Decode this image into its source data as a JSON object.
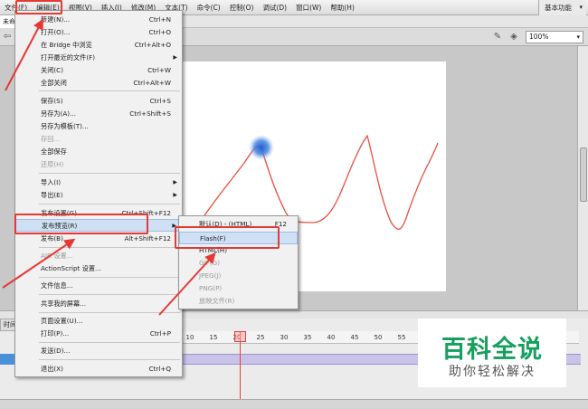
{
  "menubar": {
    "items": [
      "文件(F)",
      "编辑(E)",
      "视图(V)",
      "插入(I)",
      "修改(M)",
      "文本(T)",
      "命令(C)",
      "控制(O)",
      "调试(D)",
      "窗口(W)",
      "帮助(H)"
    ],
    "workspace": "基本功能"
  },
  "document": {
    "tab": "未命名"
  },
  "editbar": {
    "zoom": "100%"
  },
  "file_menu": {
    "items": [
      {
        "label": "新建(N)...",
        "shortcut": "Ctrl+N"
      },
      {
        "label": "打开(O)...",
        "shortcut": "Ctrl+O"
      },
      {
        "label": "在 Bridge 中浏览",
        "shortcut": "Ctrl+Alt+O"
      },
      {
        "label": "打开最近的文件(F)",
        "shortcut": ""
      },
      {
        "label": "关闭(C)",
        "shortcut": "Ctrl+W"
      },
      {
        "label": "全部关闭",
        "shortcut": "Ctrl+Alt+W"
      },
      {
        "label": "保存(S)",
        "shortcut": "Ctrl+S"
      },
      {
        "label": "另存为(A)...",
        "shortcut": "Ctrl+Shift+S"
      },
      {
        "label": "另存为模板(T)...",
        "shortcut": ""
      },
      {
        "label": "存回...",
        "shortcut": ""
      },
      {
        "label": "全部保存",
        "shortcut": ""
      },
      {
        "label": "还原(H)",
        "shortcut": ""
      },
      {
        "label": "导入(I)",
        "shortcut": ""
      },
      {
        "label": "导出(E)",
        "shortcut": ""
      },
      {
        "label": "发布设置(G)...",
        "shortcut": "Ctrl+Shift+F12"
      },
      {
        "label": "发布预览(R)",
        "shortcut": ""
      },
      {
        "label": "发布(B)",
        "shortcut": "Alt+Shift+F12"
      },
      {
        "label": "AIR 设置...",
        "shortcut": ""
      },
      {
        "label": "ActionScript 设置...",
        "shortcut": ""
      },
      {
        "label": "文件信息...",
        "shortcut": ""
      },
      {
        "label": "共享我的屏幕...",
        "shortcut": ""
      },
      {
        "label": "页面设置(U)...",
        "shortcut": ""
      },
      {
        "label": "打印(P)...",
        "shortcut": "Ctrl+P"
      },
      {
        "label": "发送(D)...",
        "shortcut": ""
      },
      {
        "label": "退出(X)",
        "shortcut": "Ctrl+Q"
      }
    ]
  },
  "preview_submenu": {
    "items": [
      {
        "label": "默认(D) - (HTML)",
        "shortcut": "F12"
      },
      {
        "label": "Flash(F)",
        "shortcut": ""
      },
      {
        "label": "HTML(H)",
        "shortcut": ""
      },
      {
        "label": "GIF(G)",
        "shortcut": ""
      },
      {
        "label": "JPEG(J)",
        "shortcut": ""
      },
      {
        "label": "PNG(P)",
        "shortcut": ""
      },
      {
        "label": "放映文件(R)",
        "shortcut": ""
      }
    ]
  },
  "timeline": {
    "tab": "时间轴",
    "ticks": [
      "10",
      "15",
      "20",
      "25",
      "30",
      "35",
      "40",
      "45",
      "50",
      "55"
    ],
    "current_frame": 20
  },
  "watermark": {
    "title": "百科全说",
    "subtitle": "助你轻松解决"
  },
  "colors": {
    "annotation": "#e53935",
    "stroke": "#e8503e",
    "brush": "#2b6fd6",
    "watermark": "#16a05d"
  }
}
